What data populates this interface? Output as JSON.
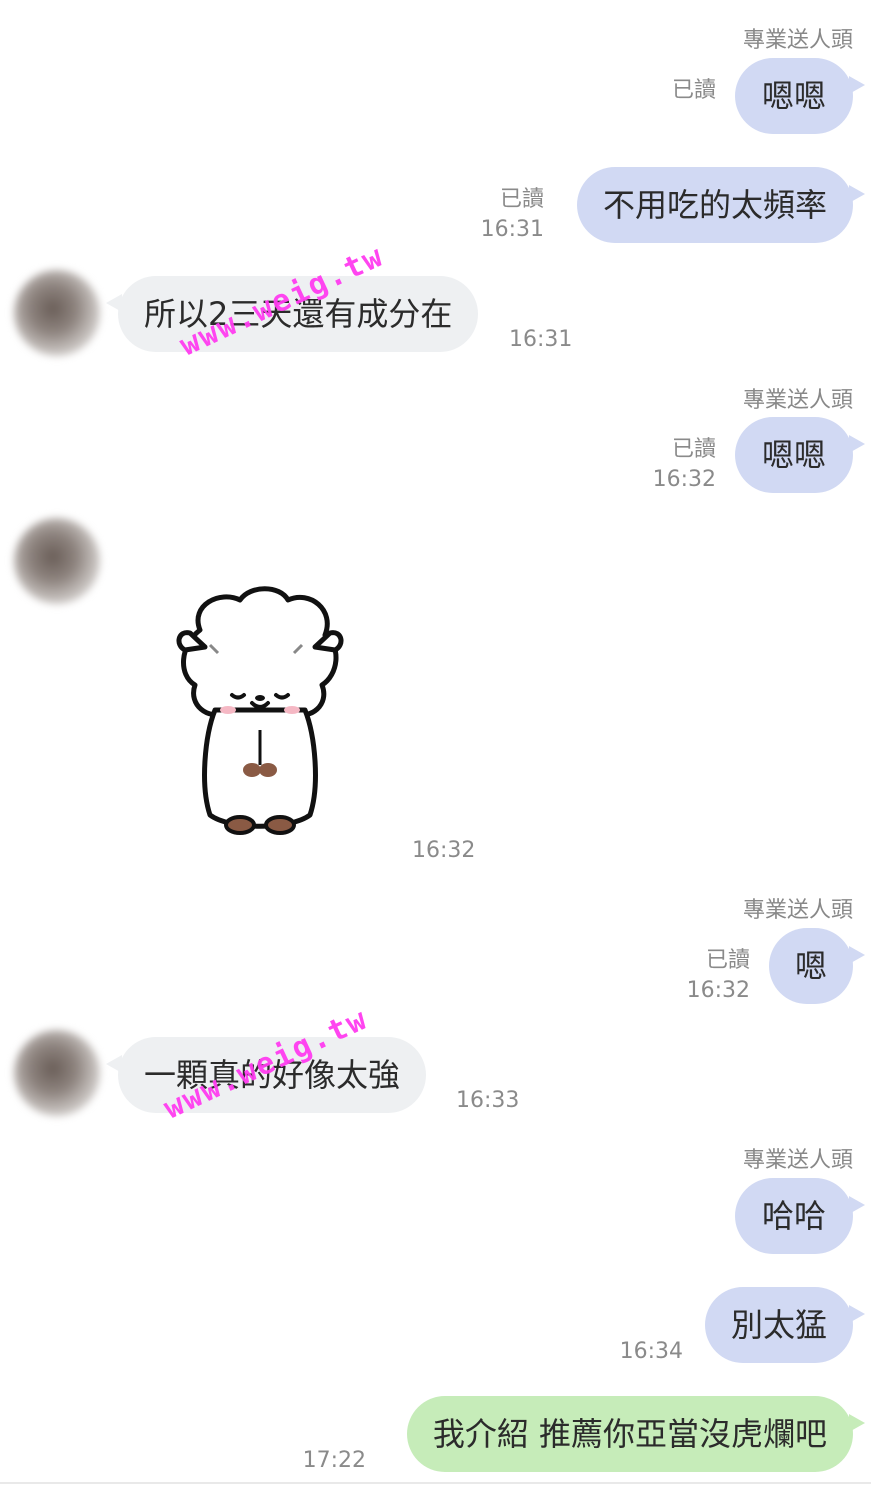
{
  "messages": [
    {
      "sender": "專業送人頭",
      "text": "嗯嗯",
      "read": "已讀",
      "time": ""
    },
    {
      "sender": "",
      "text": "不用吃的太頻率",
      "read": "已讀",
      "time": "16:31"
    },
    {
      "text": "所以2三天還有成分在",
      "time": "16:31"
    },
    {
      "sender": "專業送人頭",
      "text": "嗯嗯",
      "read": "已讀",
      "time": "16:32"
    },
    {
      "sticker": "bowing-sheep-sticker",
      "time": "16:32"
    },
    {
      "sender": "專業送人頭",
      "text": "嗯",
      "read": "已讀",
      "time": "16:32"
    },
    {
      "text": "一顆真的好像太強",
      "time": "16:33"
    },
    {
      "sender": "專業送人頭",
      "text": "哈哈",
      "read": "",
      "time": ""
    },
    {
      "text": "別太猛",
      "time": "16:34"
    },
    {
      "text": "我介紹 推薦你亞當沒虎爛吧",
      "time": "17:22"
    }
  ],
  "watermark": "www.weig.tw",
  "colors": {
    "outgoing_bubble": "#d1d9f3",
    "incoming_bubble": "#eef0f2",
    "latest_outgoing_bubble": "#c6ecb9",
    "watermark": "#ff3cf0"
  }
}
